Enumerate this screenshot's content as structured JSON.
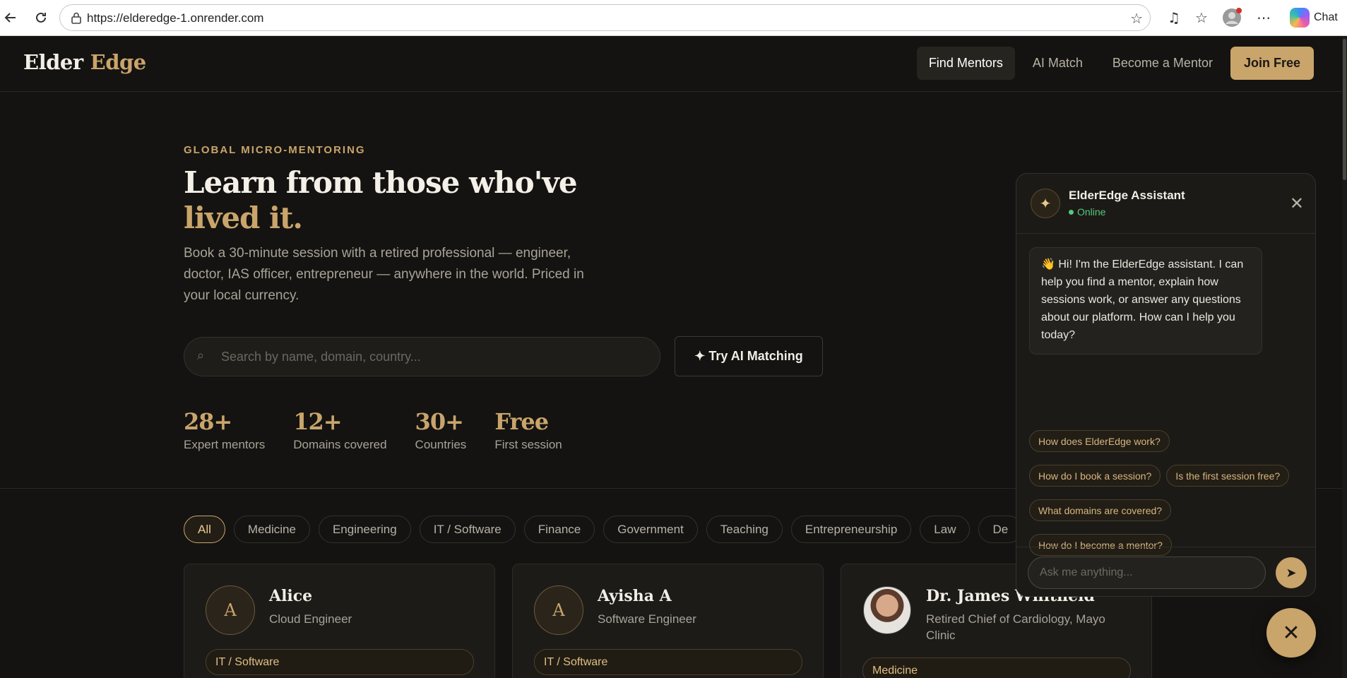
{
  "browser": {
    "url": "https://elderedge-1.onrender.com",
    "chat_label": "Chat"
  },
  "nav": {
    "logo_part1": "Elder",
    "logo_part2": "Edge",
    "links": [
      "Find Mentors",
      "AI Match",
      "Become a Mentor"
    ],
    "cta": "Join Free"
  },
  "hero": {
    "eyebrow": "GLOBAL MICRO-MENTORING",
    "title_line1": "Learn from those who've",
    "title_line2": "lived it.",
    "lead": "Book a 30-minute session with a retired professional — engineer, doctor, IAS officer, entrepreneur — anywhere in the world. Priced in your local currency.",
    "search_placeholder": "Search by name, domain, country...",
    "ai_button": "✦ Try AI Matching"
  },
  "stats": [
    {
      "num": "28+",
      "label": "Expert mentors"
    },
    {
      "num": "12+",
      "label": "Domains covered"
    },
    {
      "num": "30+",
      "label": "Countries"
    },
    {
      "num": "Free",
      "label": "First session"
    }
  ],
  "filters": [
    "All",
    "Medicine",
    "Engineering",
    "IT / Software",
    "Finance",
    "Government",
    "Teaching",
    "Entrepreneurship",
    "Law",
    "De"
  ],
  "mentors": [
    {
      "initial": "A",
      "name": "Alice",
      "role": "Cloud Engineer",
      "tag": "IT / Software"
    },
    {
      "initial": "A",
      "name": "Ayisha A",
      "role": "Software Engineer",
      "tag": "IT / Software"
    },
    {
      "initial": "",
      "name": "Dr. James Whitfield",
      "role": "Retired Chief of Cardiology, Mayo Clinic",
      "tag": "Medicine"
    }
  ],
  "chat": {
    "title": "ElderEdge Assistant",
    "status": "Online",
    "greeting": "👋 Hi! I'm the ElderEdge assistant. I can help you find a mentor, explain how sessions work, or answer any questions about our platform. How can I help you today?",
    "suggestions": [
      "How does ElderEdge work?",
      "How do I book a session?",
      "Is the first session free?",
      "What domains are covered?",
      "How do I become a mentor?"
    ],
    "input_placeholder": "Ask me anything..."
  },
  "colors": {
    "accent": "#c9a46b",
    "background": "#141311",
    "online": "#55c87a"
  }
}
